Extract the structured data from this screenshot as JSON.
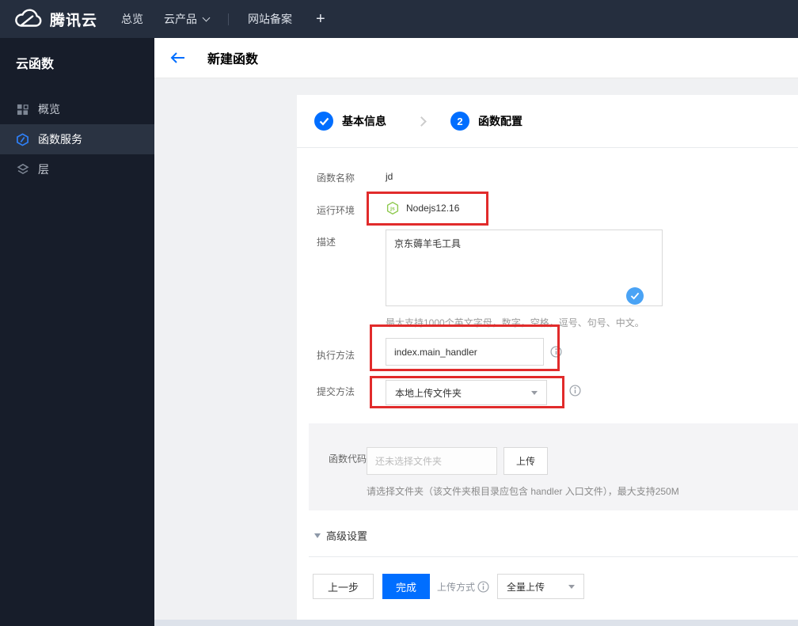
{
  "colors": {
    "accent_blue": "#006eff",
    "annotation_red": "#e12b2b",
    "nodejs_green": "#8cc84b",
    "valid_check_blue": "#4aa3f5",
    "navbar_bg": "#252e3e",
    "sidebar_bg": "#171d2a"
  },
  "navbar": {
    "brand": "腾讯云",
    "logo_icon": "tencent-cloud-logo-icon",
    "items": [
      {
        "label": "总览"
      },
      {
        "label": "云产品",
        "caret_icon": "chevron-down-icon"
      },
      {
        "label": "网站备案"
      },
      {
        "label": "+"
      }
    ]
  },
  "sidebar": {
    "title": "云函数",
    "items": [
      {
        "label": "概览",
        "icon": "grid-icon",
        "active": false
      },
      {
        "label": "函数服务",
        "icon": "function-hexagon-icon",
        "active": true
      },
      {
        "label": "层",
        "icon": "layers-icon",
        "active": false
      }
    ]
  },
  "header": {
    "back_icon": "back-arrow-icon",
    "title": "新建函数"
  },
  "steps": {
    "step1": {
      "label": "基本信息",
      "status": "completed",
      "icon": "check-icon"
    },
    "step2": {
      "label": "函数配置",
      "number": "2",
      "status": "current"
    }
  },
  "form": {
    "function_name": {
      "label": "函数名称",
      "value": "jd"
    },
    "runtime": {
      "label": "运行环境",
      "value": "Nodejs12.16",
      "icon": "nodejs-icon"
    },
    "description": {
      "label": "描述",
      "value": "京东薅羊毛工具",
      "hint": "最大支持1000个英文字母，数字，空格，逗号、句号、中文。",
      "valid_icon": "check-icon"
    },
    "handler": {
      "label": "执行方法",
      "value": "index.main_handler",
      "info": "info-icon"
    },
    "submit_method": {
      "label": "提交方法",
      "value": "本地上传文件夹",
      "info": "info-icon"
    },
    "function_code": {
      "label": "函数代码",
      "required_mark": "*",
      "placeholder": "还未选择文件夹",
      "upload_button": "上传",
      "hint": "请选择文件夹（该文件夹根目录应包含 handler 入口文件），最大支持250M"
    },
    "advanced": {
      "label": "高级设置"
    }
  },
  "footer": {
    "prev_button": "上一步",
    "finish_button": "完成",
    "upload_mode_label": "上传方式",
    "upload_mode_value": "全量上传"
  }
}
